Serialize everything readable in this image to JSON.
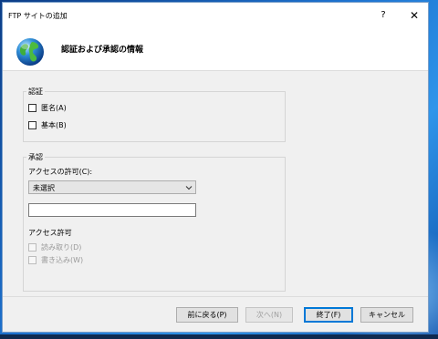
{
  "window": {
    "title": "FTP サイトの追加",
    "help_glyph": "?",
    "close_glyph": "✕"
  },
  "header": {
    "title": "認証および承認の情報",
    "icon": "globe-icon"
  },
  "authentication": {
    "group_label": "認証",
    "options": [
      {
        "label": "匿名(A)",
        "checked": false
      },
      {
        "label": "基本(B)",
        "checked": false
      }
    ]
  },
  "authorization": {
    "group_label": "承認",
    "access_label": "アクセスの許可(C):",
    "access_selected": "未選択",
    "access_text": "",
    "permission_label": "アクセス許可",
    "permissions": [
      {
        "label": "読み取り(D)",
        "enabled": false
      },
      {
        "label": "書き込み(W)",
        "enabled": false
      }
    ]
  },
  "buttons": {
    "back": "前に戻る(P)",
    "next": "次へ(N)",
    "finish": "終了(F)",
    "cancel": "キャンセル"
  },
  "colors": {
    "accent": "#0078d7",
    "dialog_bg": "#f0f0f0"
  }
}
